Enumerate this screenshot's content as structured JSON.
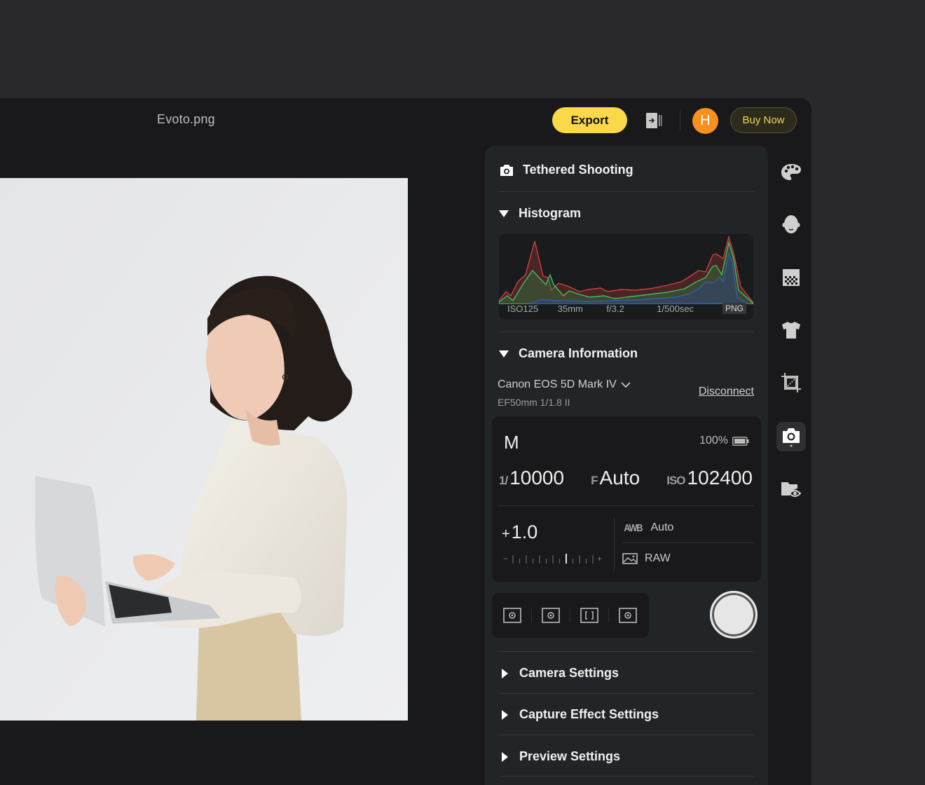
{
  "header": {
    "file_name": "Evoto.png",
    "export_label": "Export",
    "avatar_initial": "H",
    "buy_now_label": "Buy Now"
  },
  "colors": {
    "accent_yellow": "#f9d84a",
    "avatar_orange": "#f7901e",
    "buy_now_text": "#f3d65a",
    "panel_bg": "#222528",
    "app_bg": "#19191b"
  },
  "panel": {
    "title": "Tethered Shooting",
    "histogram": {
      "label": "Histogram",
      "expanded": true,
      "iso": "ISO125",
      "focal_length": "35mm",
      "aperture": "f/3.2",
      "shutter": "1/500sec",
      "format_badge": "PNG"
    },
    "camera_info": {
      "label": "Camera Information",
      "expanded": true,
      "camera_model": "Canon EOS 5D Mark IV",
      "lens": "EF50mm 1/1.8 II",
      "disconnect_label": "Disconnect",
      "mode": "M",
      "battery": "100%",
      "shutter_prefix": "1/",
      "shutter_value": "10000",
      "aperture_prefix": "F",
      "aperture_value": "Auto",
      "iso_prefix": "ISO",
      "iso_value": "102400",
      "ev_sign": "+",
      "ev_value": "1.0",
      "ev_scale_minus": "−",
      "ev_scale_plus": "+",
      "white_balance_icon": "AWB",
      "white_balance": "Auto",
      "image_format": "RAW"
    },
    "metering_modes": [
      {
        "name": "evaluative-metering-icon"
      },
      {
        "name": "partial-metering-icon"
      },
      {
        "name": "spot-frame-icon"
      },
      {
        "name": "center-weighted-metering-icon"
      }
    ],
    "collapsed_sections": [
      {
        "label": "Camera Settings"
      },
      {
        "label": "Capture Effect Settings"
      },
      {
        "label": "Preview Settings"
      }
    ]
  },
  "sidebar": {
    "items": [
      {
        "icon": "palette-icon",
        "active": false
      },
      {
        "icon": "face-icon",
        "active": false
      },
      {
        "icon": "background-icon",
        "active": false
      },
      {
        "icon": "clothing-icon",
        "active": false
      },
      {
        "icon": "crop-icon",
        "active": false
      },
      {
        "icon": "camera-icon",
        "active": true
      },
      {
        "icon": "folder-preview-icon",
        "active": false
      }
    ]
  }
}
